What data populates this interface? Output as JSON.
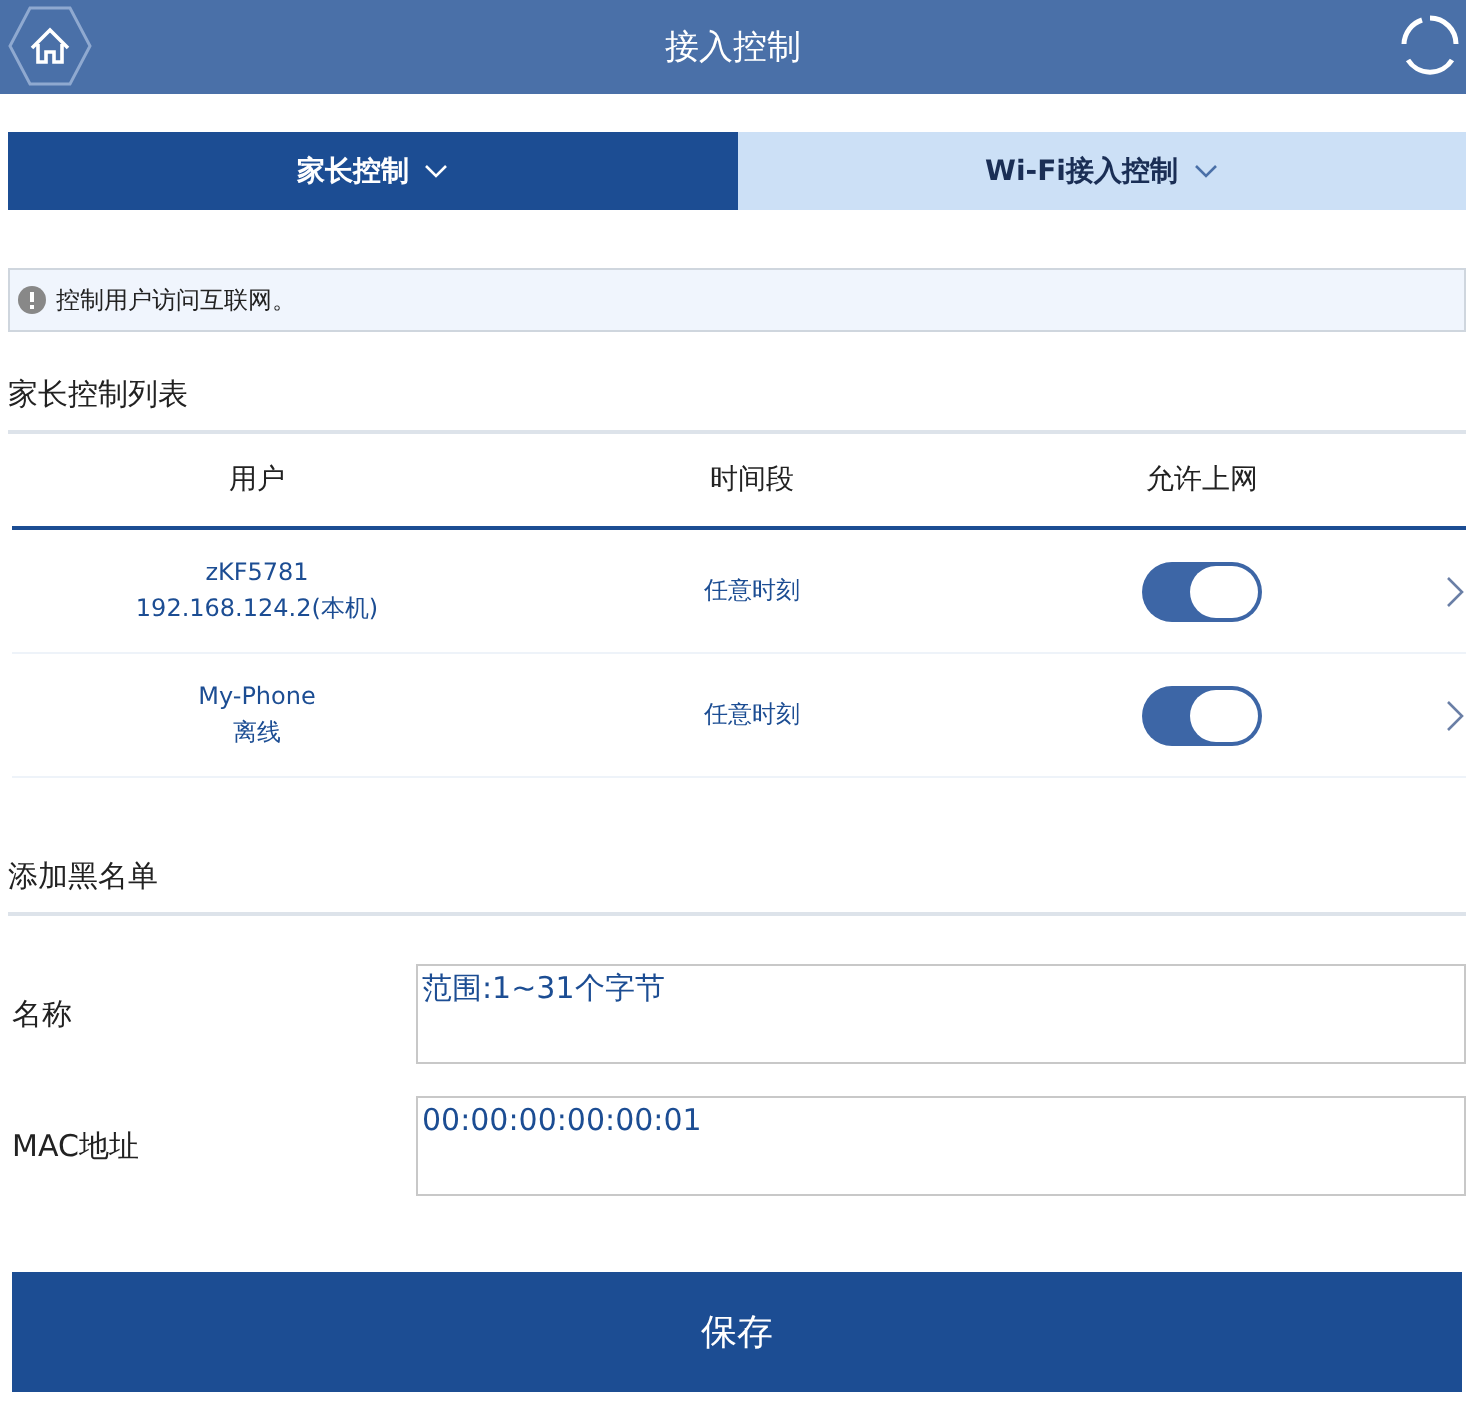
{
  "header": {
    "title": "接入控制"
  },
  "tabs": [
    {
      "label": "家长控制",
      "selected": true
    },
    {
      "label": "Wi-Fi接入控制",
      "selected": false
    }
  ],
  "notice": "控制用户访问互联网。",
  "parental_list": {
    "title": "家长控制列表",
    "columns": [
      "用户",
      "时间段",
      "允许上网"
    ],
    "rows": [
      {
        "name": "zKF5781",
        "detail": "192.168.124.2(本机)",
        "period": "任意时刻",
        "allowed": true
      },
      {
        "name": "My-Phone",
        "detail": "离线",
        "period": "任意时刻",
        "allowed": true
      }
    ]
  },
  "blacklist": {
    "title": "添加黑名单",
    "fields": [
      {
        "label": "名称",
        "placeholder": "范围:1~31个字节"
      },
      {
        "label": "MAC地址",
        "value": "00:00:00:00:00:01"
      }
    ]
  },
  "save_button": "保存"
}
